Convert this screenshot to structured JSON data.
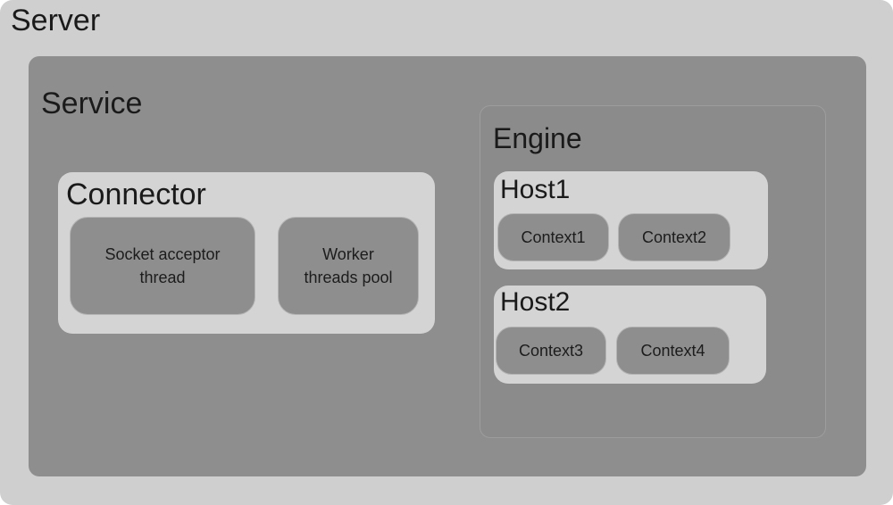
{
  "server": {
    "label": "Server"
  },
  "service": {
    "label": "Service"
  },
  "connector": {
    "label": "Connector",
    "socket_acceptor": "Socket acceptor\nthread",
    "worker_pool": "Worker\nthreads pool"
  },
  "engine": {
    "label": "Engine",
    "hosts": [
      {
        "label": "Host1",
        "contexts": [
          "Context1",
          "Context2"
        ]
      },
      {
        "label": "Host2",
        "contexts": [
          "Context3",
          "Context4"
        ]
      }
    ]
  }
}
